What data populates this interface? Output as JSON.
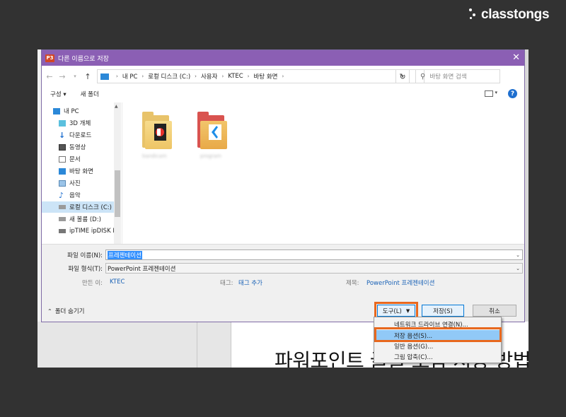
{
  "brand": {
    "name": "classtongs"
  },
  "dialog": {
    "title": "다른 이름으로 저장",
    "app_icon_text": "P3",
    "address": {
      "crumbs": [
        "내 PC",
        "로컬 디스크 (C:)",
        "사용자",
        "KTEC",
        "바탕 화면"
      ]
    },
    "search_placeholder": "바탕 화면 검색",
    "toolbar": {
      "organize": "구성 ▾",
      "new_folder": "새 폴더"
    },
    "nav_items": [
      {
        "label": "내 PC",
        "icon": "computer-icon"
      },
      {
        "label": "3D 개체",
        "icon": "cube-icon"
      },
      {
        "label": "다운로드",
        "icon": "download-arrow-icon"
      },
      {
        "label": "동영상",
        "icon": "video-icon"
      },
      {
        "label": "문서",
        "icon": "document-icon"
      },
      {
        "label": "바탕 화면",
        "icon": "desktop-icon"
      },
      {
        "label": "사진",
        "icon": "picture-icon"
      },
      {
        "label": "음악",
        "icon": "music-note-icon"
      },
      {
        "label": "로컬 디스크 (C:)",
        "icon": "drive-icon",
        "selected": true
      },
      {
        "label": "새 볼륨 (D:)",
        "icon": "drive-icon"
      },
      {
        "label": "ipTIME ipDISK D",
        "icon": "network-drive-icon"
      }
    ],
    "files": [
      {
        "name": "bandicam",
        "icon": "folder-icon"
      },
      {
        "name": "program",
        "icon": "folder-icon"
      }
    ],
    "filename_label": "파일 이름(N):",
    "filename_value": "프레젠테이션",
    "filetype_label": "파일 형식(T):",
    "filetype_value": "PowerPoint 프레젠테이션",
    "authors_label": "만든 이:",
    "authors_value": "KTEC",
    "tags_label": "태그:",
    "tags_value": "태그 추가",
    "title_label": "제목:",
    "title_value": "PowerPoint 프레젠테이션",
    "hide_folders": "폴더 숨기기",
    "tools_button": "도구(L)",
    "save_button": "저장(S)",
    "cancel_button": "취소",
    "tools_menu": [
      "네트워크 드라이브 연결(N)...",
      "저장 옵션(S)...",
      "일반 옵션(G)...",
      "그림 압축(C)..."
    ]
  },
  "slide": {
    "text": "파워포인트 글꼴 포함 저장 방법을"
  },
  "colors": {
    "titlebar": "#8b5fb4",
    "highlight": "#e8681e",
    "selection": "#3390ff"
  }
}
